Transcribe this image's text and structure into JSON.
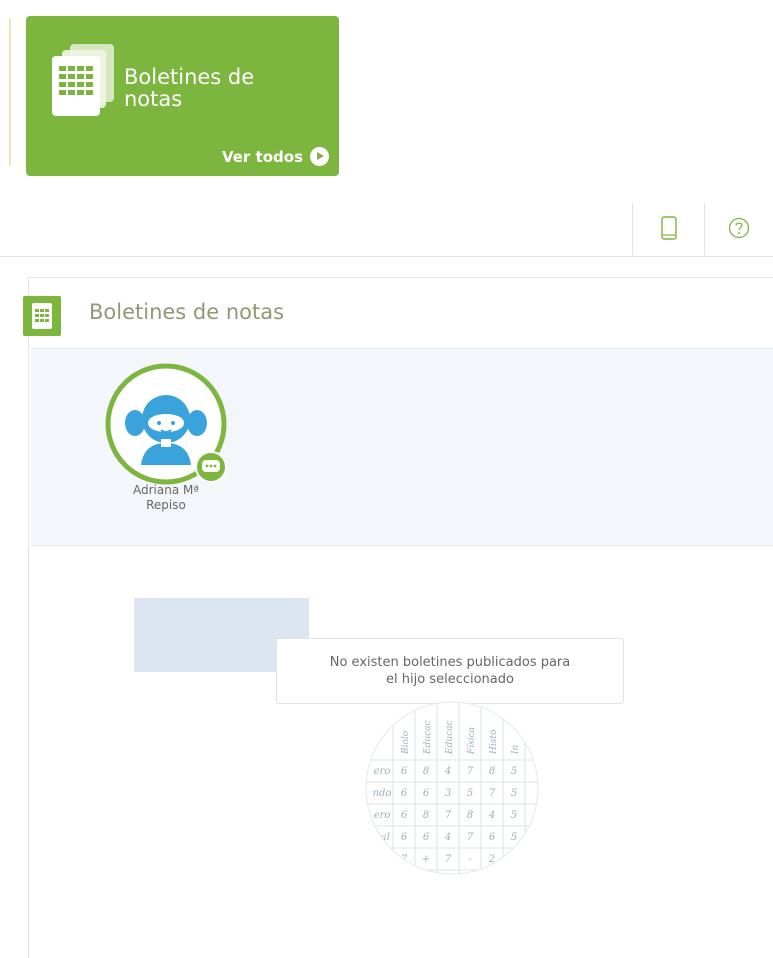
{
  "tile": {
    "title": "Boletines de notas",
    "link_label": "Ver todos",
    "color": "#7db63f",
    "icon": "report-card-icon",
    "link_icon": "play-circle-icon"
  },
  "toolbar": {
    "tablet_icon": "tablet-icon",
    "help_icon": "help-circle-icon"
  },
  "panel": {
    "title": "Boletines de notas",
    "icon": "report-card-icon"
  },
  "children": [
    {
      "name_line1": "Adriana Mª",
      "name_line2": "Repiso",
      "avatar_icon": "girl-avatar-icon",
      "badge_icon": "chat-bubble-icon"
    }
  ],
  "empty_state": {
    "message_line1": "No existen boletines publicados para",
    "message_line2": "el hijo seleccionado",
    "illustration": "grades-table-icon",
    "grade_rows": [
      [
        "ero",
        "6",
        "8",
        "4",
        "7",
        "8",
        "5"
      ],
      [
        "ndo",
        "6",
        "6",
        "3",
        "5",
        "7",
        "5"
      ],
      [
        "ero",
        "6",
        "8",
        "7",
        "8",
        "4",
        "5"
      ],
      [
        "nal",
        "6",
        "6",
        "4",
        "7",
        "6",
        "5"
      ],
      [
        "",
        "7",
        "+",
        "7",
        "-",
        "2",
        ""
      ]
    ],
    "grade_headers": [
      "Biolo",
      "Educac",
      "Educac",
      "Física",
      "Histo",
      "In"
    ]
  }
}
